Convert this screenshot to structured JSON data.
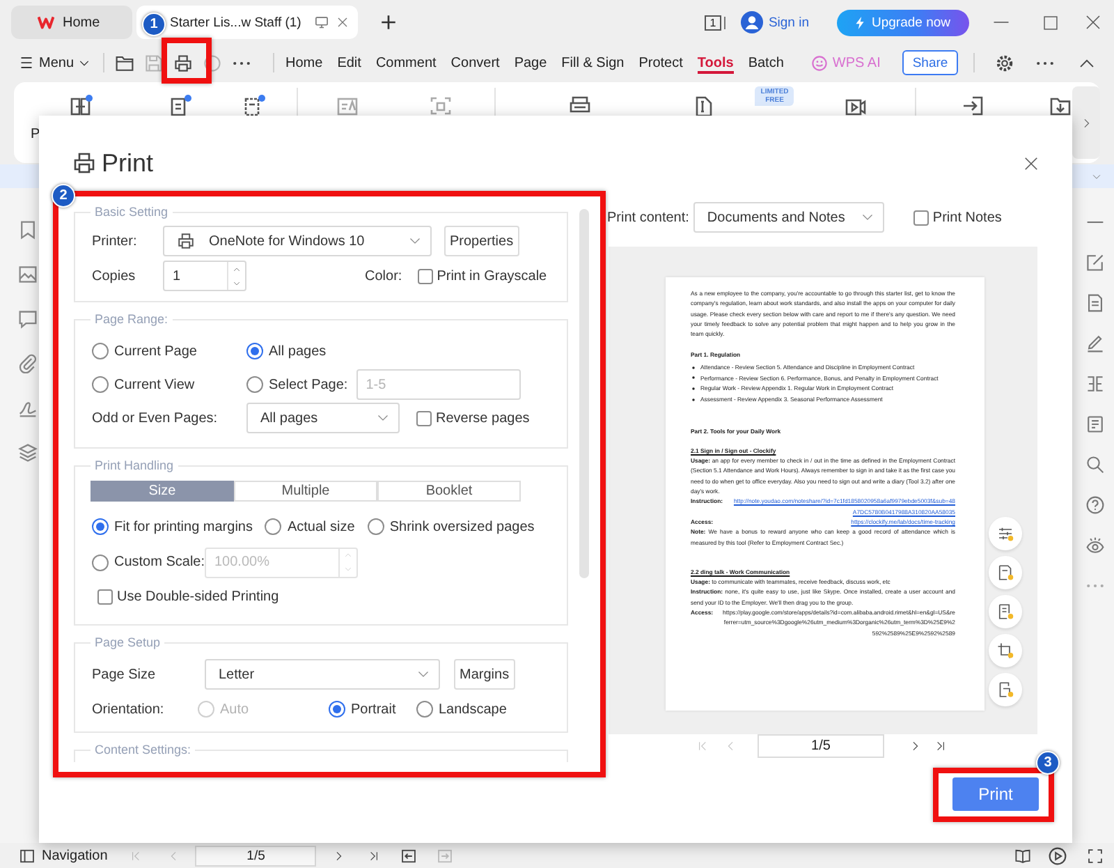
{
  "tabs": [
    {
      "kind": "home",
      "label": "Home",
      "selected": false
    },
    {
      "kind": "document",
      "label": "Starter Lis...w Staff (1)",
      "selected": true
    }
  ],
  "title_bar": {
    "window_count": "1",
    "sign_in": "Sign in",
    "upgrade": "Upgrade now"
  },
  "menu_bar": {
    "menu": "Menu",
    "items": [
      {
        "label": "Home",
        "selected": false
      },
      {
        "label": "Edit",
        "selected": false
      },
      {
        "label": "Comment",
        "selected": false
      },
      {
        "label": "Convert",
        "selected": false
      },
      {
        "label": "Page",
        "selected": false
      },
      {
        "label": "Fill & Sign",
        "selected": false
      },
      {
        "label": "Protect",
        "selected": false
      },
      {
        "label": "Tools",
        "selected": true
      },
      {
        "label": "Batch",
        "selected": false
      }
    ],
    "ai": "WPS AI",
    "share": "Share"
  },
  "ribbon": {
    "cut_label": "P",
    "badge": "LIMITED FREE"
  },
  "print_dialog": {
    "title": "Print",
    "basic_setting": {
      "legend": "Basic Setting",
      "printer_label": "Printer:",
      "printer": "OneNote for Windows 10",
      "properties": "Properties",
      "copies_label": "Copies",
      "copies": "1",
      "color_label": "Color:",
      "grayscale": {
        "label": "Print in Grayscale",
        "checked": false
      }
    },
    "page_range": {
      "legend": "Page Range:",
      "options": [
        {
          "label": "Current Page",
          "selected": false
        },
        {
          "label": "All pages",
          "selected": true
        },
        {
          "label": "Current View",
          "selected": false
        },
        {
          "label": "Select Page:",
          "selected": false
        }
      ],
      "select_pages": {
        "placeholder": "1-5"
      },
      "subset_label": "Odd or Even Pages:",
      "subset": "All pages",
      "reverse": {
        "label": "Reverse pages",
        "checked": false
      }
    },
    "print_handling": {
      "legend": "Print Handling",
      "tabs": [
        {
          "label": "Size",
          "selected": true
        },
        {
          "label": "Multiple",
          "selected": false
        },
        {
          "label": "Booklet",
          "selected": false
        }
      ],
      "scale_options": [
        {
          "label": "Fit for printing margins",
          "selected": true
        },
        {
          "label": "Actual size",
          "selected": false
        },
        {
          "label": "Shrink oversized pages",
          "selected": false
        },
        {
          "label": "Custom Scale:",
          "selected": false
        }
      ],
      "custom_scale": {
        "value": "100.00%",
        "disabled": true
      },
      "double_sided": {
        "label": "Use Double-sided Printing",
        "checked": false
      }
    },
    "page_setup": {
      "legend": "Page Setup",
      "size_label": "Page Size",
      "size": "Letter",
      "margins": "Margins",
      "orientation_label": "Orientation:",
      "orientations": [
        {
          "label": "Auto",
          "selected": false,
          "disabled": true
        },
        {
          "label": "Portrait",
          "selected": true,
          "disabled": false
        },
        {
          "label": "Landscape",
          "selected": false,
          "disabled": false
        }
      ]
    },
    "content_settings": {
      "legend": "Content Settings:"
    },
    "print_content": {
      "label": "Print content:",
      "value": "Documents and Notes",
      "print_notes": {
        "label": "Print Notes",
        "checked": false
      }
    },
    "preview": {
      "blocks": [
        {
          "kind": "text",
          "text": "As a new employee to the company, you're accountable to go through this starter list, get to know the company's regulation, learn about work standards, and also install the apps on your computer for daily usage. Please check every section below with care and report to me if there's any question. We need your timely feedback to solve any potential problem that might happen and to help you grow in the team quickly."
        },
        {
          "kind": "heading",
          "text": "Part 1. Regulation"
        },
        {
          "kind": "bullet",
          "text": "Attendance - Review Section 5. Attendance and Discipline in Employment Contract"
        },
        {
          "kind": "bullet",
          "text": "Performance - Review Section 6. Performance, Bonus, and Penalty in Employment Contract"
        },
        {
          "kind": "bullet",
          "text": "Regular Work - Review Appendix 1. Regular Work in Employment Contract"
        },
        {
          "kind": "bullet",
          "text": "Assessment - Review Appendix 3. Seasonal Performance Assessment"
        },
        {
          "kind": "heading",
          "text": "Part 2. Tools for your Daily Work"
        },
        {
          "kind": "subheading",
          "text": "2.1 Sign in / Sign out - Clockify"
        },
        {
          "kind": "text",
          "text": "**Usage:** an app for every member to check in / out in the time as defined in the Employment Contract (Section 5.1 Attendance and Work Hours). Always remember to sign in and take it as the first case you need to do when get to office everyday. Also you need to sign out and write a diary (Tool 3.2) after one day's work."
        },
        {
          "kind": "link",
          "label": "Instruction:",
          "value": "http://note.youdao.com/noteshare/?id=7c1fd1858020958a6af9979ebde5003f&sub=48A7DC5780B0417988A310820AA58035"
        },
        {
          "kind": "link",
          "label": "Access:",
          "value": "https://clockify.me/lab/docs/time-tracking"
        },
        {
          "kind": "text",
          "text": "**Note:** We have a bonus to reward anyone who can keep a good record of attendance which is measured by this tool (Refer to Employment Contract Sec.)"
        },
        {
          "kind": "subheading",
          "text": "2.2 ding talk - Work Communication"
        },
        {
          "kind": "text",
          "text": "**Usage:** to communicate with teammates, receive feedback, discuss work, etc"
        },
        {
          "kind": "text",
          "text": "**Instruction:** none, it's quite easy to use, just like Skype. Once installed, create a user account and send your ID to the Employer. We'll then drag you to the group."
        },
        {
          "kind": "field",
          "label": "Access:",
          "value": "https://play.google.com/store/apps/details?id=com.alibaba.android.rimet&hl=en&gl=US&referrer=utm_source%3Dgoogle%26utm_medium%3Dorganic%26utm_term%3D%25E9%2592%2589%25E9%2592%2589"
        }
      ]
    },
    "pagination": {
      "page": "1/5"
    },
    "print_button": "Print"
  },
  "status_bar": {
    "navigation": "Navigation",
    "page": "1/5"
  },
  "annotations": [
    {
      "number": "1"
    },
    {
      "number": "2"
    },
    {
      "number": "3"
    }
  ]
}
